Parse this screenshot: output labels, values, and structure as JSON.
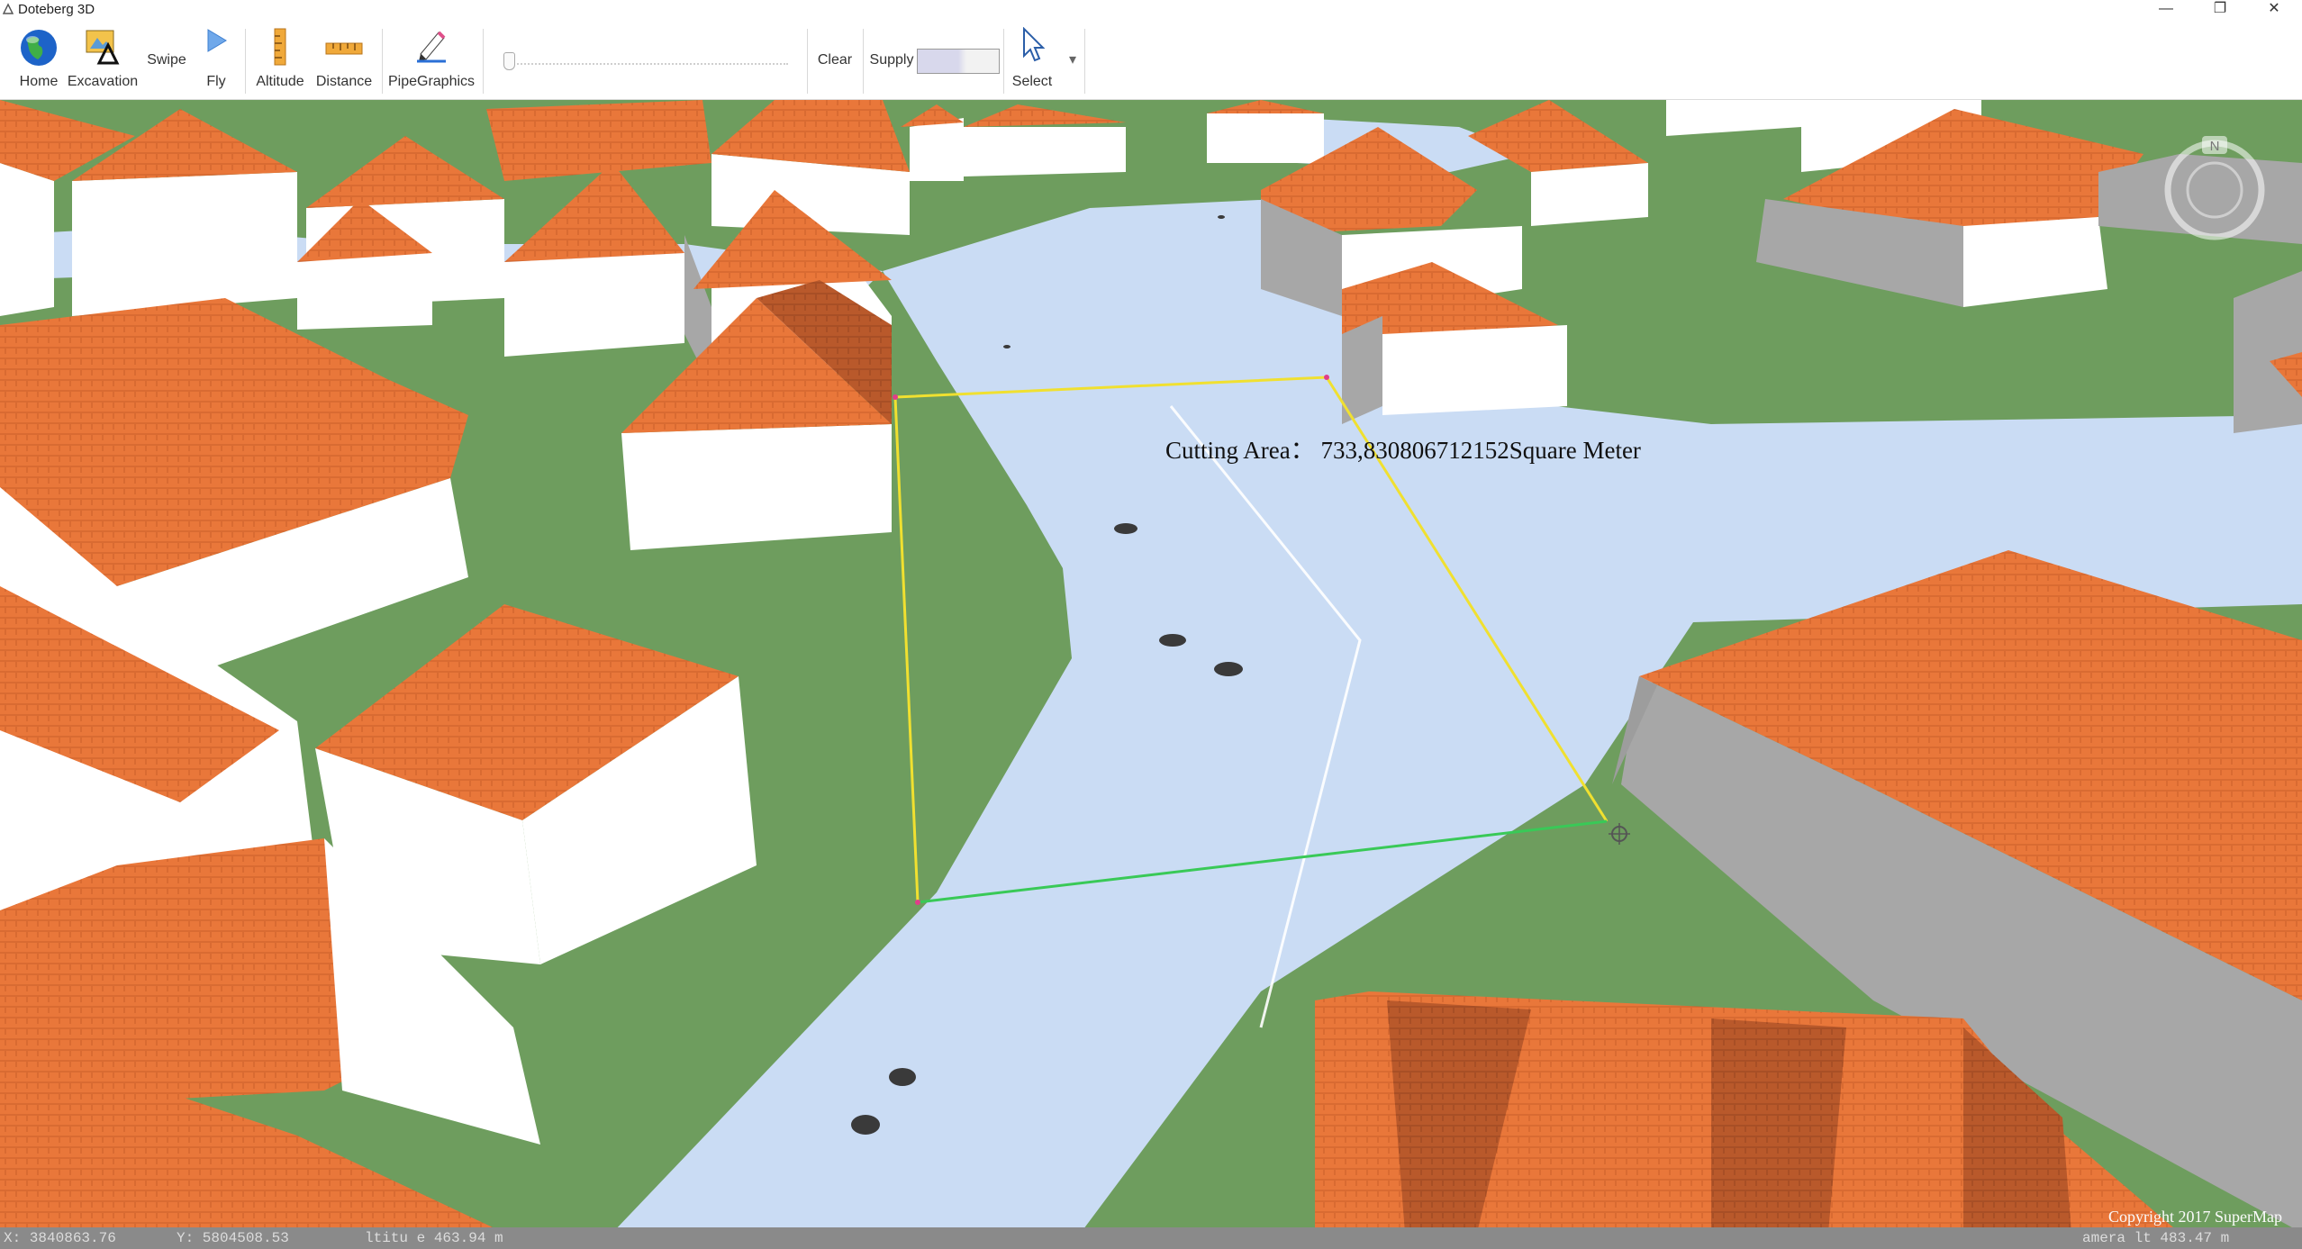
{
  "window": {
    "title": "Doteberg 3D",
    "controls": [
      "—",
      "❐",
      "✕"
    ]
  },
  "toolbar": {
    "home_label": "Home",
    "excavation_label": "Excavation",
    "swipe_label": "Swipe",
    "fly_label": "Fly",
    "altitude_label": "Altitude",
    "distance_label": "Distance",
    "pipegraphics_label": "PipeGraphics",
    "clear_label": "Clear",
    "supply_label": "Supply",
    "select_label": "Select",
    "overflow_glyph": "▾"
  },
  "map": {
    "annotation": "Cutting Area：  733,830806712152Square Meter",
    "compass_label": "N",
    "copyright": "Copyright 2017 SuperMap"
  },
  "statusbar": {
    "x_readout": "X: 3840863.76",
    "y_readout": "Y: 5804508.53",
    "altitude_readout": "ltitu  e  463.94 m",
    "camera_readout": "amera  lt  483.47 m"
  },
  "colors": {
    "grass": "#6e9d5e",
    "road": "#cadcf4",
    "roof": "#e9773a",
    "roof_dark": "#b9592b",
    "wall": "#ffffff",
    "wall_shade": "#a7a7a7",
    "selection_yellow": "#f0e030",
    "selection_green": "#39c957"
  }
}
